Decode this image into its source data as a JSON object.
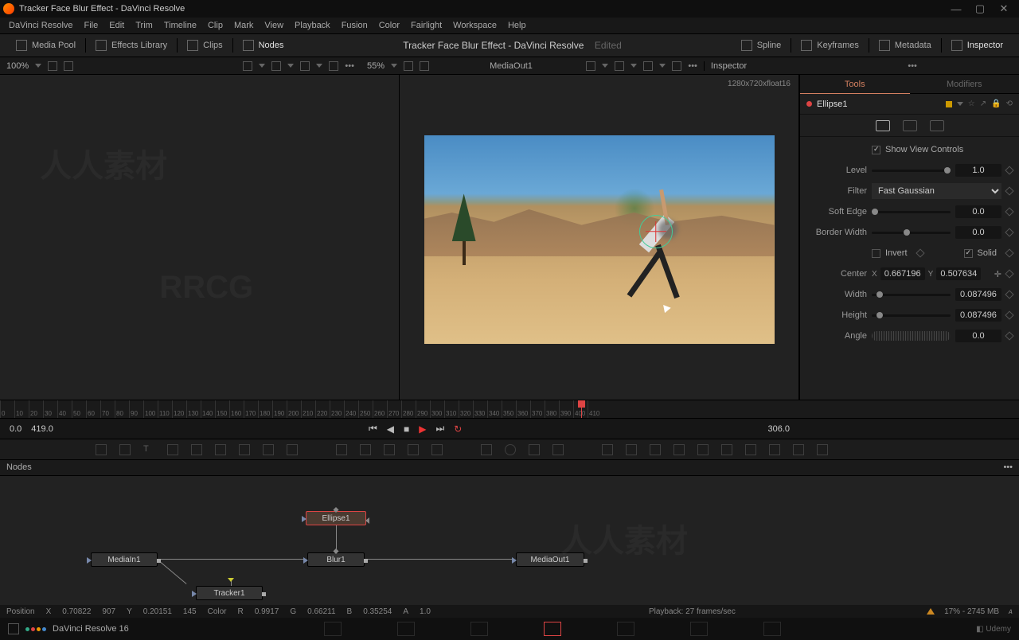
{
  "window": {
    "title": "Tracker Face Blur Effect - DaVinci Resolve"
  },
  "menu": [
    "DaVinci Resolve",
    "File",
    "Edit",
    "Trim",
    "Timeline",
    "Clip",
    "Mark",
    "View",
    "Playback",
    "Fusion",
    "Color",
    "Fairlight",
    "Workspace",
    "Help"
  ],
  "panel_tabs": {
    "left": [
      {
        "icon": "media-pool-icon",
        "label": "Media Pool"
      },
      {
        "icon": "effects-library-icon",
        "label": "Effects Library"
      },
      {
        "icon": "clips-icon",
        "label": "Clips"
      },
      {
        "icon": "nodes-icon",
        "label": "Nodes"
      }
    ],
    "center_title": "Tracker Face Blur Effect - DaVinci Resolve",
    "center_status": "Edited",
    "right": [
      {
        "icon": "spline-icon",
        "label": "Spline"
      },
      {
        "icon": "keyframes-icon",
        "label": "Keyframes"
      },
      {
        "icon": "metadata-icon",
        "label": "Metadata"
      },
      {
        "icon": "inspector-icon",
        "label": "Inspector",
        "active": true
      }
    ]
  },
  "viewers": {
    "left_zoom": "100%",
    "right_zoom": "55%",
    "right_node": "MediaOut1",
    "resolution": "1280x720xfloat16"
  },
  "inspector": {
    "title": "Inspector",
    "tabs": {
      "tools": "Tools",
      "modifiers": "Modifiers"
    },
    "node_name": "Ellipse1",
    "show_view_controls": "Show View Controls",
    "props": {
      "level": {
        "label": "Level",
        "value": "1.0"
      },
      "filter": {
        "label": "Filter",
        "value": "Fast Gaussian"
      },
      "soft_edge": {
        "label": "Soft Edge",
        "value": "0.0"
      },
      "border_width": {
        "label": "Border Width",
        "value": "0.0"
      },
      "invert": {
        "label": "Invert"
      },
      "solid": {
        "label": "Solid"
      },
      "center": {
        "label": "Center",
        "x": "0.667196",
        "y": "0.507634"
      },
      "width": {
        "label": "Width",
        "value": "0.087496"
      },
      "height": {
        "label": "Height",
        "value": "0.087496"
      },
      "angle": {
        "label": "Angle",
        "value": "0.0"
      }
    }
  },
  "ruler_ticks": [
    "0",
    "10",
    "20",
    "30",
    "40",
    "50",
    "60",
    "70",
    "80",
    "90",
    "100",
    "110",
    "120",
    "130",
    "140",
    "150",
    "160",
    "170",
    "180",
    "190",
    "200",
    "210",
    "220",
    "230",
    "240",
    "250",
    "260",
    "270",
    "280",
    "290",
    "300",
    "310",
    "320",
    "330",
    "340",
    "350",
    "360",
    "370",
    "380",
    "390",
    "400",
    "410"
  ],
  "transport": {
    "start": "0.0",
    "end": "419.0",
    "current": "306.0"
  },
  "nodes_panel": {
    "title": "Nodes",
    "nodes": {
      "mediain": "MediaIn1",
      "tracker": "Tracker1",
      "ellipse": "Ellipse1",
      "blur": "Blur1",
      "mediaout": "MediaOut1"
    }
  },
  "status": {
    "pos_label": "Position",
    "pos_x_label": "X",
    "pos_x": "0.70822",
    "pos_x_px": "907",
    "pos_y_label": "Y",
    "pos_y": "0.20151",
    "pos_y_px": "145",
    "color_label": "Color",
    "r_label": "R",
    "r": "0.9917",
    "g_label": "G",
    "g": "0.66211",
    "b_label": "B",
    "b": "0.35254",
    "a_label": "A",
    "a": "1.0",
    "playback": "Playback: 27 frames/sec",
    "mem": "17% - 2745 MB"
  },
  "footer": {
    "version": "DaVinci Resolve 16",
    "brand": "Udemy"
  }
}
